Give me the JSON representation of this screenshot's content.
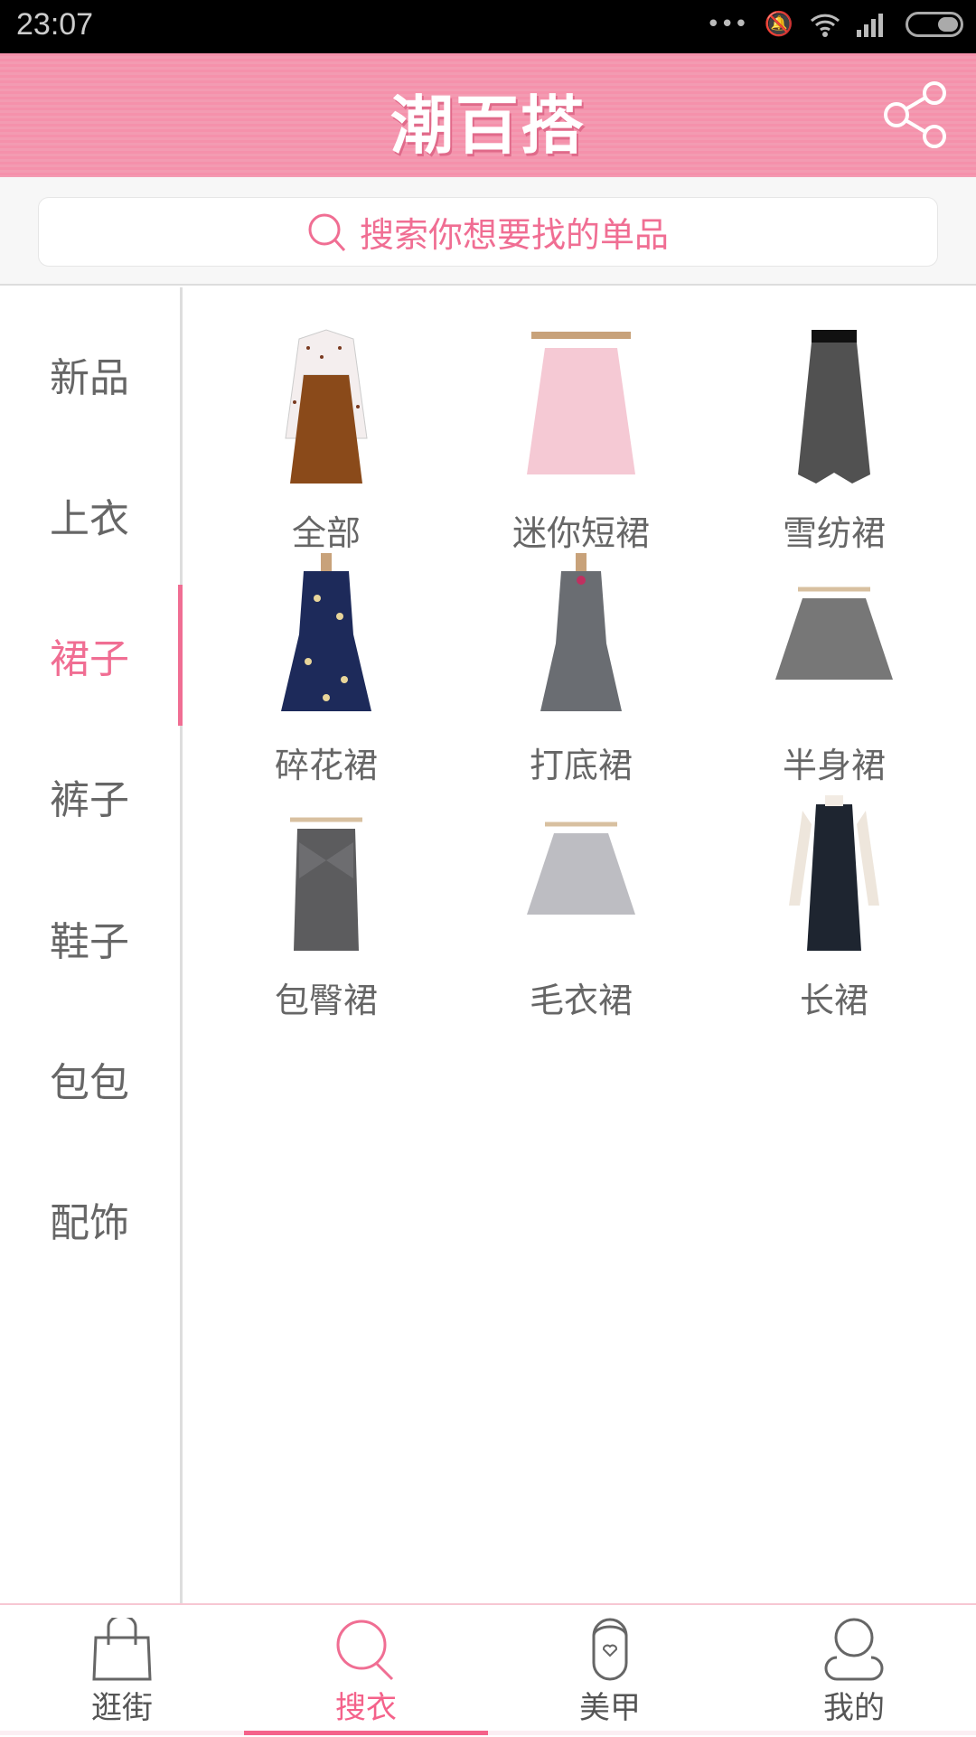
{
  "status_bar": {
    "time": "23:07"
  },
  "header": {
    "title": "潮百搭"
  },
  "search": {
    "placeholder": "搜索你想要找的单品"
  },
  "sidebar": {
    "items": [
      {
        "label": "新品"
      },
      {
        "label": "上衣"
      },
      {
        "label": "裙子"
      },
      {
        "label": "裤子"
      },
      {
        "label": "鞋子"
      },
      {
        "label": "包包"
      },
      {
        "label": "配饰"
      }
    ],
    "active": "裙子"
  },
  "grid": {
    "items": [
      {
        "label": "全部"
      },
      {
        "label": "迷你短裙"
      },
      {
        "label": "雪纺裙"
      },
      {
        "label": "碎花裙"
      },
      {
        "label": "打底裙"
      },
      {
        "label": "半身裙"
      },
      {
        "label": "包臀裙"
      },
      {
        "label": "毛衣裙"
      },
      {
        "label": "长裙"
      }
    ]
  },
  "bottom_nav": {
    "items": [
      {
        "label": "逛街"
      },
      {
        "label": "搜衣"
      },
      {
        "label": "美甲"
      },
      {
        "label": "我的"
      }
    ],
    "active": "搜衣"
  },
  "colors": {
    "accent": "#f06e93",
    "header": "#f591ab"
  }
}
